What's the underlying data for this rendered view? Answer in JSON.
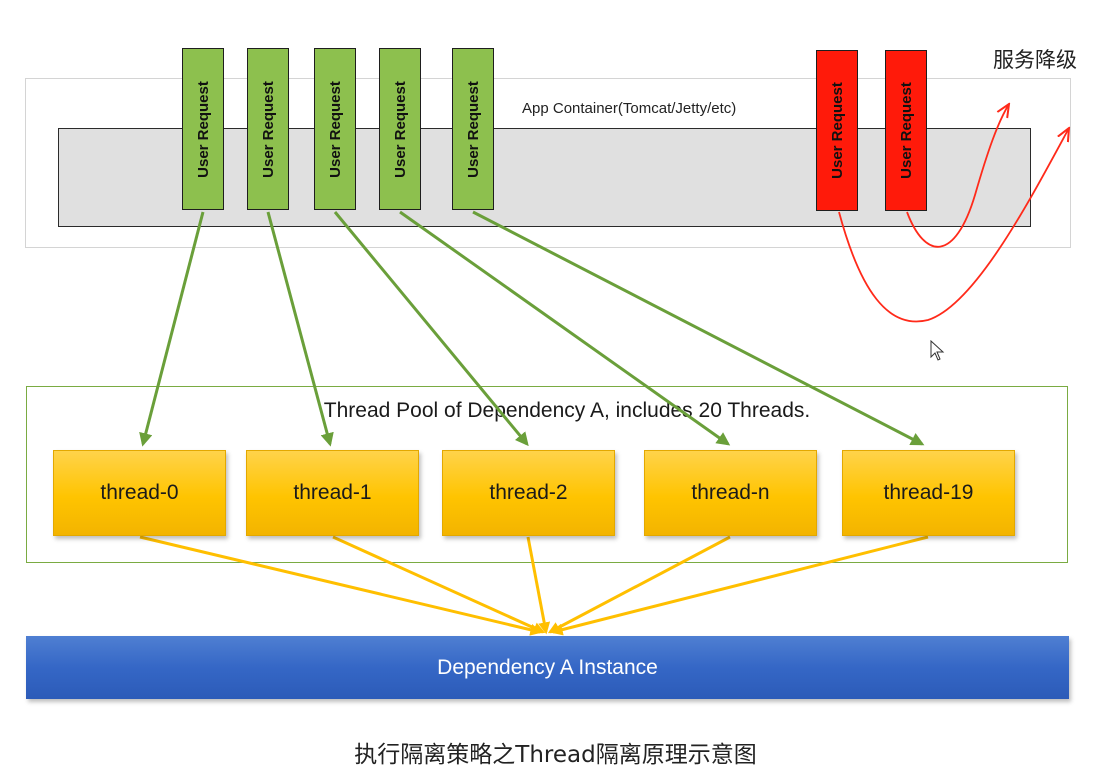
{
  "app_container": {
    "label": "App Container(Tomcat/Jetty/etc)"
  },
  "degrade": {
    "label": "服务降级"
  },
  "requests": {
    "green": [
      "User Request",
      "User Request",
      "User Request",
      "User Request",
      "User Request"
    ],
    "red": [
      "User Request",
      "User Request"
    ]
  },
  "thread_pool": {
    "label": "Thread Pool of Dependency A, includes 20 Threads.",
    "threads": [
      "thread-0",
      "thread-1",
      "thread-2",
      "thread-n",
      "thread-19"
    ]
  },
  "dependency": {
    "label": "Dependency A Instance"
  },
  "caption": "执行隔离策略之Thread隔离原理示意图",
  "colors": {
    "request_green": "#8dc04e",
    "request_red": "#ff1a0a",
    "arrow_green": "#6a9f3a",
    "arrow_red": "#ff2a1a",
    "arrow_yellow": "#ffbf00",
    "thread_fill": "#ffc400",
    "dependency_fill": "#3567c6"
  },
  "icons": {
    "cursor": "mouse-pointer-icon"
  }
}
